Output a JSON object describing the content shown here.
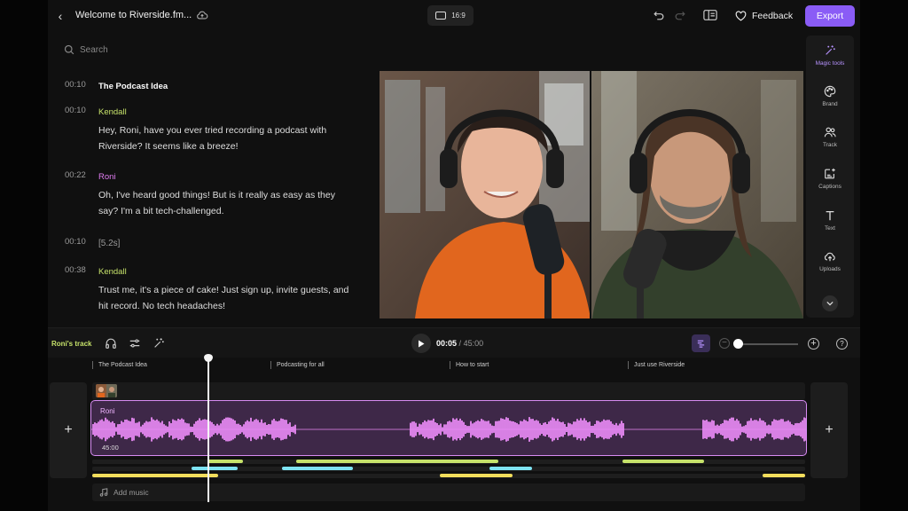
{
  "header": {
    "title": "Welcome to Riverside.fm...",
    "aspect_ratio": "16:9",
    "feedback_label": "Feedback",
    "export_label": "Export"
  },
  "search": {
    "placeholder": "Search"
  },
  "transcript": {
    "rows": [
      {
        "time": "00:10",
        "kind": "chapter",
        "text": "The Podcast Idea"
      },
      {
        "time": "00:10",
        "kind": "speaker-kendall",
        "text": "Kendall"
      },
      {
        "time": "",
        "kind": "body",
        "text": "Hey, Roni, have you ever tried recording a podcast with Riverside? It seems like a breeze!"
      },
      {
        "time": "00:22",
        "kind": "speaker-roni",
        "text": "Roni"
      },
      {
        "time": "",
        "kind": "body",
        "text": "Oh, I've heard good things! But is it really as easy as they say? I'm a bit tech-challenged."
      },
      {
        "time": "00:10",
        "kind": "pause",
        "text": "[5.2s]"
      },
      {
        "time": "00:38",
        "kind": "speaker-kendall",
        "text": "Kendall"
      },
      {
        "time": "",
        "kind": "body",
        "text": "Trust me, it's a piece of cake! Just sign up, invite guests, and hit record. No tech headaches!"
      }
    ]
  },
  "tools": [
    {
      "label": "Magic tools",
      "icon": "magic-wand-icon",
      "active": true
    },
    {
      "label": "Brand",
      "icon": "palette-icon",
      "active": false
    },
    {
      "label": "Track",
      "icon": "people-icon",
      "active": false
    },
    {
      "label": "Captions",
      "icon": "captions-icon",
      "active": false
    },
    {
      "label": "Text",
      "icon": "text-icon",
      "active": false
    },
    {
      "label": "Uploads",
      "icon": "upload-icon",
      "active": false
    }
  ],
  "timeline": {
    "track_label": "Roni's track",
    "current_time": "00:05",
    "total_time": "45:00",
    "chapters": [
      "The Podcast Idea",
      "Podcasting for all",
      "How to start",
      "Just use Riverside"
    ],
    "clip": {
      "name": "Roni",
      "duration": "45:00"
    },
    "add_music_label": "Add music",
    "zoom_level": 0.0
  },
  "colors": {
    "accent": "#8a5cf6",
    "speaker_kendall": "#c6e26a",
    "speaker_roni": "#e07cf0",
    "waveform": "#e98af5",
    "lane_yellow": "#f2dd5c",
    "lane_green": "#c6e26a",
    "lane_cyan": "#7ee3f2"
  }
}
